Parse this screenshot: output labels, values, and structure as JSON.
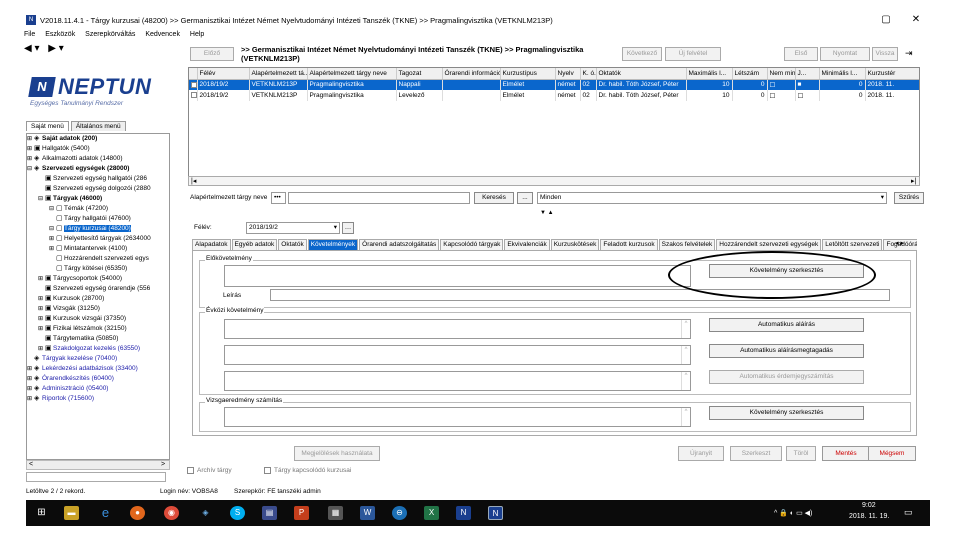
{
  "window": {
    "title": "V2018.11.4.1 - Tárgy kurzusai (48200) >> Germanisztikai Intézet Német Nyelvtudományi Intézeti Tanszék (TKNE) >> Pragmalingvisztika (VETKNLM213P)",
    "minimize": "▢",
    "close": "✕"
  },
  "menu": [
    "File",
    "Eszközök",
    "Szerepkörváltás",
    "Kedvencek",
    "Help"
  ],
  "nav": {
    "back": "◀ ▾",
    "forward": "▶ ▾"
  },
  "logo": {
    "name": "NEPTUN",
    "tagline": "Egységes Tanulmányi Rendszer"
  },
  "left_tabs": [
    "Saját menü",
    "Általános menü"
  ],
  "tree": [
    {
      "label": "Saját adatok (200)",
      "level": 0,
      "toggle": "⊞",
      "icon": "◈",
      "style": "bold"
    },
    {
      "label": "Hallgatók (5400)",
      "level": 0,
      "toggle": "⊞",
      "icon": "▣",
      "style": ""
    },
    {
      "label": "Alkalmazotti adatok (14800)",
      "level": 0,
      "toggle": "⊞",
      "icon": "◈",
      "style": ""
    },
    {
      "label": "Szervezeti egységek (28000)",
      "level": 0,
      "toggle": "⊟",
      "icon": "◈",
      "style": "bold"
    },
    {
      "label": "Szervezeti egység hallgatói (286",
      "level": 1,
      "toggle": "",
      "icon": "▣",
      "style": ""
    },
    {
      "label": "Szervezeti egység dolgozói (2880",
      "level": 1,
      "toggle": "",
      "icon": "▣",
      "style": ""
    },
    {
      "label": "Tárgyak (46000)",
      "level": 1,
      "toggle": "⊟",
      "icon": "▣",
      "style": "bold"
    },
    {
      "label": "Témák (47200)",
      "level": 2,
      "toggle": "⊟",
      "icon": "▢",
      "style": ""
    },
    {
      "label": "Tárgy hallgatói (47600)",
      "level": 2,
      "toggle": "",
      "icon": "▢",
      "style": ""
    },
    {
      "label": "Tárgy kurzusai (48200)",
      "level": 2,
      "toggle": "⊟",
      "icon": "▢",
      "style": "selected"
    },
    {
      "label": "Helyettesítő tárgyak (2634000",
      "level": 2,
      "toggle": "⊞",
      "icon": "▢",
      "style": ""
    },
    {
      "label": "Mintatantervek (4100)",
      "level": 2,
      "toggle": "⊞",
      "icon": "▢",
      "style": ""
    },
    {
      "label": "Hozzárendelt szervezeti egys",
      "level": 2,
      "toggle": "",
      "icon": "▢",
      "style": ""
    },
    {
      "label": "Tárgy kötései (65350)",
      "level": 2,
      "toggle": "",
      "icon": "▢",
      "style": ""
    },
    {
      "label": "Tárgycsoportok (54000)",
      "level": 1,
      "toggle": "⊞",
      "icon": "▣",
      "style": ""
    },
    {
      "label": "Szervezeti egység órarendje (556",
      "level": 1,
      "toggle": "",
      "icon": "▣",
      "style": ""
    },
    {
      "label": "Kurzusok (28700)",
      "level": 1,
      "toggle": "⊞",
      "icon": "▣",
      "style": ""
    },
    {
      "label": "Vizsgák (31250)",
      "level": 1,
      "toggle": "⊞",
      "icon": "▣",
      "style": ""
    },
    {
      "label": "Kurzusok vizsgái (37350)",
      "level": 1,
      "toggle": "⊞",
      "icon": "▣",
      "style": ""
    },
    {
      "label": "Fizikai létszámok (32150)",
      "level": 1,
      "toggle": "⊞",
      "icon": "▣",
      "style": ""
    },
    {
      "label": "Tárgytematika (50850)",
      "level": 1,
      "toggle": "",
      "icon": "▣",
      "style": ""
    },
    {
      "label": "Szakdolgozat kezelés (63550)",
      "level": 1,
      "toggle": "⊞",
      "icon": "▣",
      "style": "blue"
    },
    {
      "label": "Tárgyak kezelése (70400)",
      "level": 0,
      "toggle": "",
      "icon": "◈",
      "style": "blue"
    },
    {
      "label": "Lekérdezési adatbázisok (33400)",
      "level": 0,
      "toggle": "⊞",
      "icon": "◈",
      "style": "blue"
    },
    {
      "label": "Órarendkészítés (60400)",
      "level": 0,
      "toggle": "⊞",
      "icon": "◈",
      "style": "blue"
    },
    {
      "label": "Adminisztráció (05400)",
      "level": 0,
      "toggle": "⊞",
      "icon": "◈",
      "style": "blue"
    },
    {
      "label": "Riportok (715600)",
      "level": 0,
      "toggle": "⊞",
      "icon": "◈",
      "style": "blue"
    }
  ],
  "tree_scroll": {
    "left": "<",
    "right": ">"
  },
  "status": {
    "records": "Letöltve 2 / 2 rekord.",
    "user": "Login név: VOBSA8",
    "role": "Szerepkör: FE tanszéki admin"
  },
  "toolbar": {
    "prev": "Előző",
    "breadcrumb": ">> Germanisztikai Intézet Német Nyelvtudományi Intézeti Tanszék (TKNE) >> Pragmalingvisztika (VETKNLM213P)",
    "next": "Következő",
    "new": "Új felvétel",
    "edit_data": "Adatok kezelése",
    "first": "Első",
    "print": "Nyomtat",
    "back": "Vissza"
  },
  "grid": {
    "columns": [
      "Félév",
      "Alapértelmezett tá...",
      "Alapértelmezett tárgy neve",
      "Tagozat",
      "Órarendi információ...",
      "Kurzustípus",
      "Nyelv",
      "K. ó.",
      "Oktatók",
      "Maximális l...",
      "Létszám",
      "Nem mind...",
      "J...",
      "Minimális l...",
      "Kurzustér"
    ],
    "rows": [
      {
        "selected": true,
        "cells": [
          "2018/19/2",
          "VETKNLM213P",
          "Pragmalingvisztika",
          "Nappali",
          "",
          "Elmélet",
          "német",
          "02",
          "Dr. habil. Tóth József, Péter",
          "10",
          "0",
          "☐",
          "■",
          "0",
          "2018. 11."
        ]
      },
      {
        "selected": false,
        "cells": [
          "2018/19/2",
          "VETKNLM213P",
          "Pragmalingvisztika",
          "Levelező",
          "",
          "Elmélet",
          "német",
          "02",
          "Dr. habil. Tóth József, Péter",
          "10",
          "0",
          "☐",
          "☐",
          "0",
          "2018. 11."
        ]
      }
    ]
  },
  "filter": {
    "label": "Alapértelmezett tárgy neve",
    "dots": "•••",
    "search": "Keresés",
    "more": "...",
    "scope": "Minden",
    "scope_arrow": "▾",
    "filter_btn": "Szűrés",
    "splitter": "▼ ▲"
  },
  "term": {
    "label": "Félév:",
    "value": "2018/19/2",
    "arrow": "▾",
    "picker": "…"
  },
  "detail_tabs": [
    "Alapadatok",
    "Egyéb adatok",
    "Oktatók",
    "Követelmények",
    "Órarendi adatszolgáltatás",
    "Kapcsolódó tárgyak",
    "Ekvivalenciák",
    "Kurzuskötések",
    "Feladott kurzusok",
    "Szakos felvételek",
    "Hozzárendelt szervezeti egységek",
    "Letöltött szervezeti",
    "Fogadóórák"
  ],
  "tab_scroll": {
    "left": "◂",
    "right": "▸"
  },
  "active_tab": "Követelmények",
  "requirements": {
    "prereq_group": "Előkövetelmény",
    "desc_label": "Leírás",
    "term_group": "Évközi követelmény",
    "exam_group": "Vizsgaeredmény számítás",
    "btn_req_editor": "Követelmény szerkesztés",
    "btn_auto_sign": "Automatikus aláírás",
    "btn_auto_offer": "Automatikus aláírásmegtagadás",
    "btn_auto_grade": "Automatikus érdemjegyszámítás",
    "btn_req_editor2": "Követelmény szerkesztés",
    "scroll_up": "^",
    "scroll_down": "v"
  },
  "bottom": {
    "save_all": "Megjelölések használata",
    "chk_archive": "Archív tárgy",
    "chk_show_all": "Tárgy kapcsolódó kurzusai",
    "cancel": "Újranyit",
    "save": "Szerkeszt",
    "delete": "Töröl",
    "store": "Mentés",
    "abort": "Mégsem"
  },
  "taskbar": {
    "tray_icons": "^  🔒  ◐  ▭  ◀)",
    "time": "9:02",
    "date": "2018. 11. 19."
  }
}
